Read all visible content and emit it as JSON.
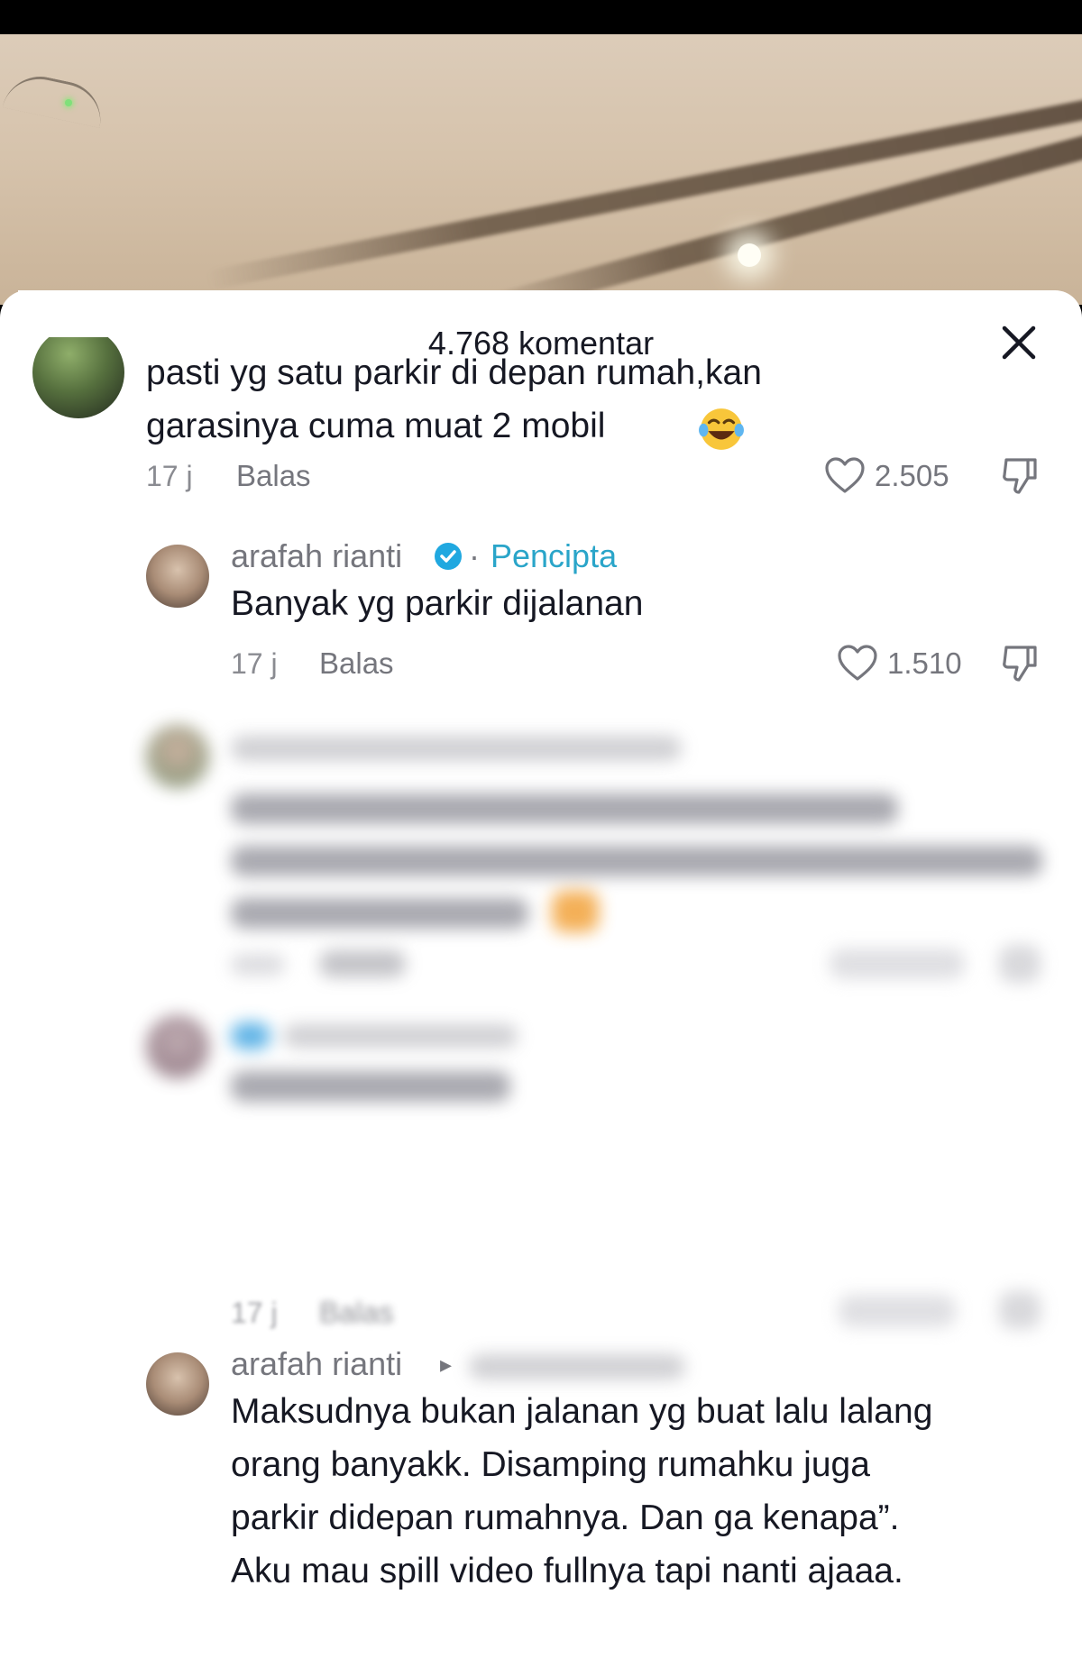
{
  "sheet": {
    "title": "4.768 komentar",
    "close_icon": "close-icon"
  },
  "comments": [
    {
      "text_line1": "pasti yg satu parkir di depan rumah,kan",
      "text_line2": "garasinya cuma muat 2 mobil",
      "emoji": "laughing-crying-emoji",
      "time": "17 j",
      "reply_label": "Balas",
      "likes": "2.505"
    }
  ],
  "replies": [
    {
      "username": "arafah rianti",
      "badge_sep": "·",
      "badge": "Pencipta",
      "text": "Banyak yg parkir dijalanan",
      "time": "17 j",
      "reply_label": "Balas",
      "likes": "1.510"
    },
    {
      "username": "arafah rianti",
      "arrow": "▸",
      "text_lines": [
        "Maksudnya bukan jalanan yg buat lalu lalang",
        "orang banyakk. Disamping rumahku juga",
        "parkir didepan rumahnya. Dan ga kenapa”.",
        "Aku mau spill video fullnya tapi nanti ajaaa."
      ]
    }
  ],
  "blurred_replies": [
    {
      "time": "17 j",
      "reply_label": "Balas"
    }
  ],
  "colors": {
    "accent_creator": "#2aa5c9",
    "verified": "#20a8e0",
    "text": "#161823",
    "muted": "#75767d"
  }
}
